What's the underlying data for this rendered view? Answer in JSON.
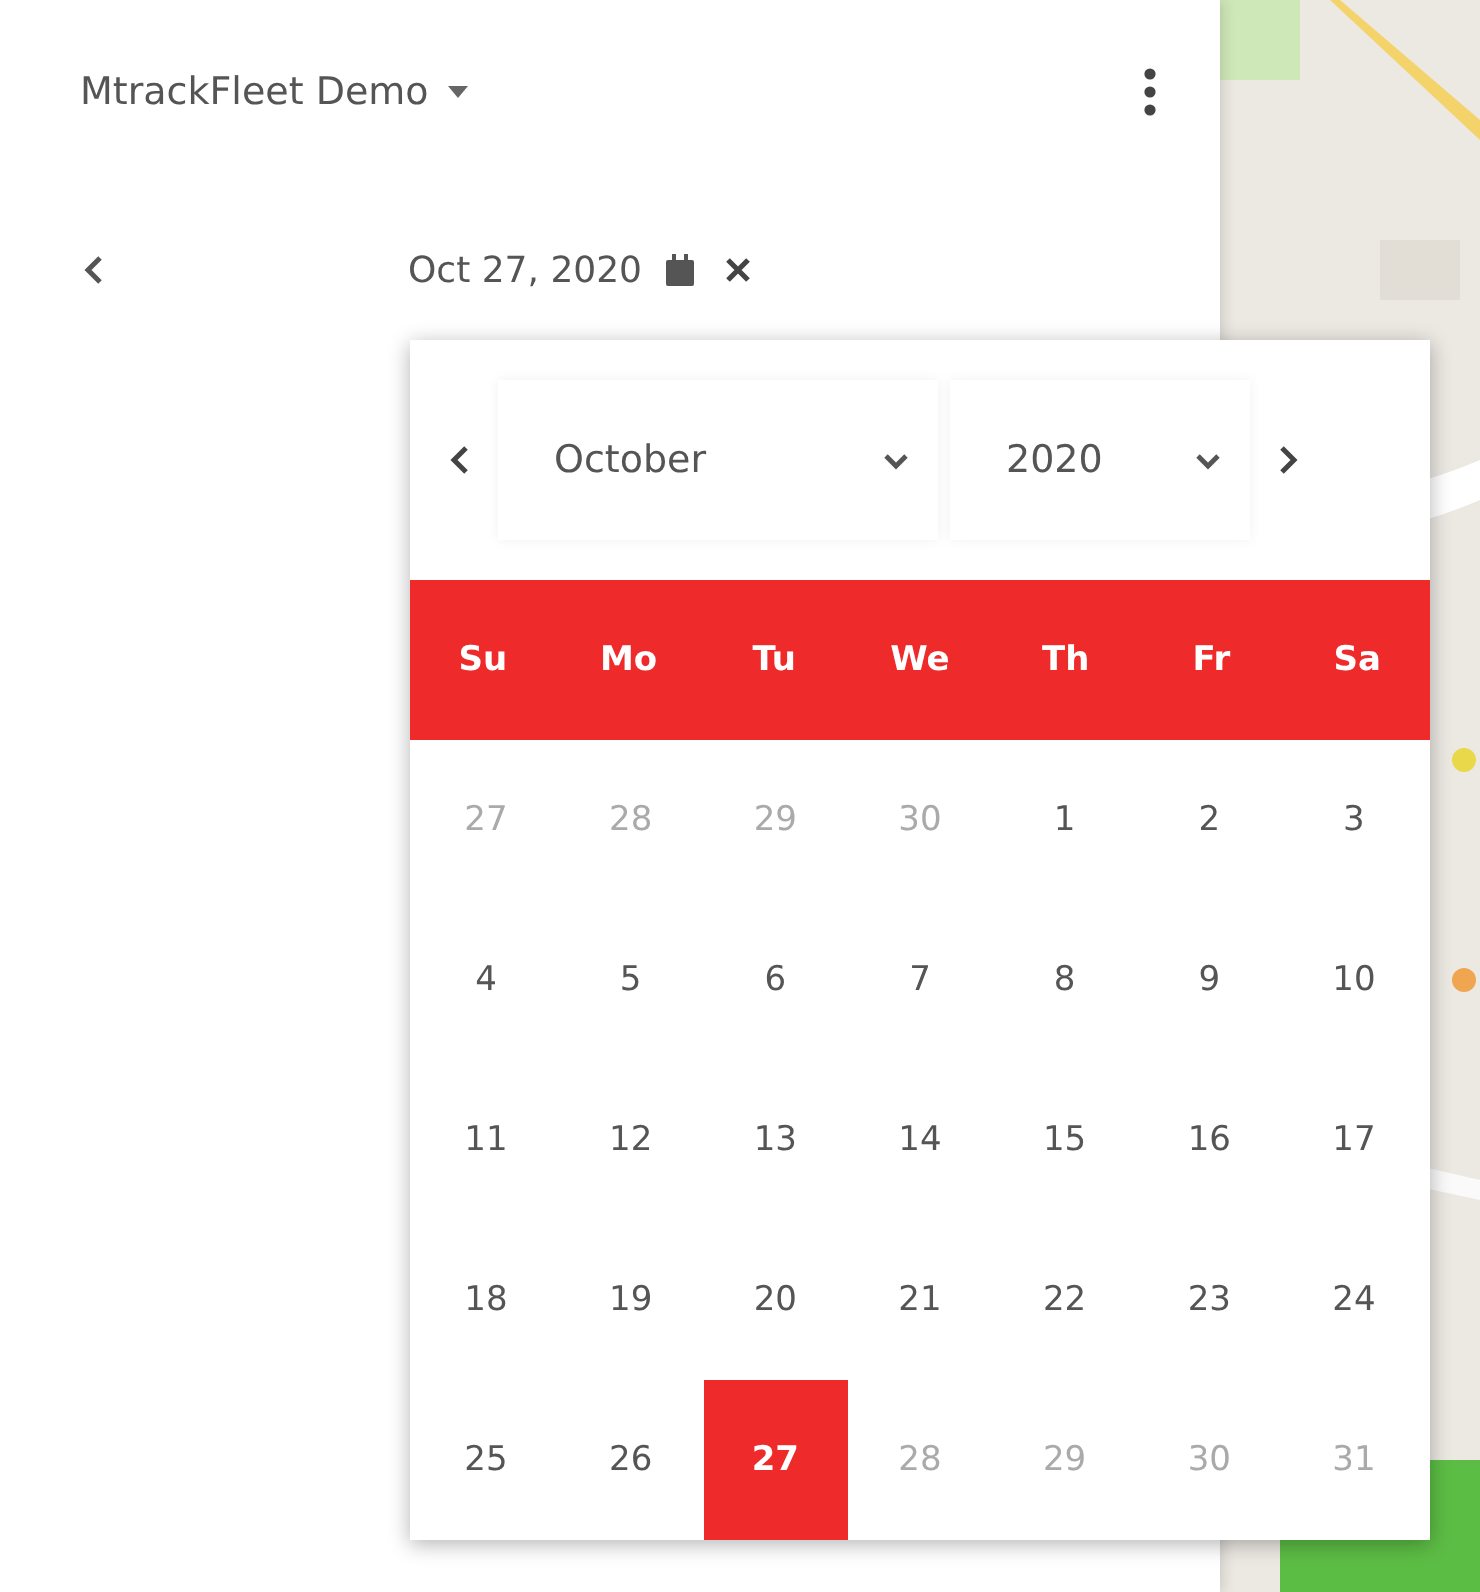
{
  "header": {
    "title": "MtrackFleet Demo"
  },
  "date_bar": {
    "date": "Oct 27, 2020"
  },
  "datepicker": {
    "month": "October",
    "year": "2020",
    "weekdays": [
      "Su",
      "Mo",
      "Tu",
      "We",
      "Th",
      "Fr",
      "Sa"
    ],
    "weeks": [
      [
        {
          "label": "27",
          "outside": true,
          "selected": false
        },
        {
          "label": "28",
          "outside": true,
          "selected": false
        },
        {
          "label": "29",
          "outside": true,
          "selected": false
        },
        {
          "label": "30",
          "outside": true,
          "selected": false
        },
        {
          "label": "1",
          "outside": false,
          "selected": false
        },
        {
          "label": "2",
          "outside": false,
          "selected": false
        },
        {
          "label": "3",
          "outside": false,
          "selected": false
        }
      ],
      [
        {
          "label": "4",
          "outside": false,
          "selected": false
        },
        {
          "label": "5",
          "outside": false,
          "selected": false
        },
        {
          "label": "6",
          "outside": false,
          "selected": false
        },
        {
          "label": "7",
          "outside": false,
          "selected": false
        },
        {
          "label": "8",
          "outside": false,
          "selected": false
        },
        {
          "label": "9",
          "outside": false,
          "selected": false
        },
        {
          "label": "10",
          "outside": false,
          "selected": false
        }
      ],
      [
        {
          "label": "11",
          "outside": false,
          "selected": false
        },
        {
          "label": "12",
          "outside": false,
          "selected": false
        },
        {
          "label": "13",
          "outside": false,
          "selected": false
        },
        {
          "label": "14",
          "outside": false,
          "selected": false
        },
        {
          "label": "15",
          "outside": false,
          "selected": false
        },
        {
          "label": "16",
          "outside": false,
          "selected": false
        },
        {
          "label": "17",
          "outside": false,
          "selected": false
        }
      ],
      [
        {
          "label": "18",
          "outside": false,
          "selected": false
        },
        {
          "label": "19",
          "outside": false,
          "selected": false
        },
        {
          "label": "20",
          "outside": false,
          "selected": false
        },
        {
          "label": "21",
          "outside": false,
          "selected": false
        },
        {
          "label": "22",
          "outside": false,
          "selected": false
        },
        {
          "label": "23",
          "outside": false,
          "selected": false
        },
        {
          "label": "24",
          "outside": false,
          "selected": false
        }
      ],
      [
        {
          "label": "25",
          "outside": false,
          "selected": false
        },
        {
          "label": "26",
          "outside": false,
          "selected": false
        },
        {
          "label": "27",
          "outside": false,
          "selected": true
        },
        {
          "label": "28",
          "outside": true,
          "selected": false
        },
        {
          "label": "29",
          "outside": true,
          "selected": false
        },
        {
          "label": "30",
          "outside": true,
          "selected": false
        },
        {
          "label": "31",
          "outside": true,
          "selected": false
        }
      ]
    ]
  }
}
